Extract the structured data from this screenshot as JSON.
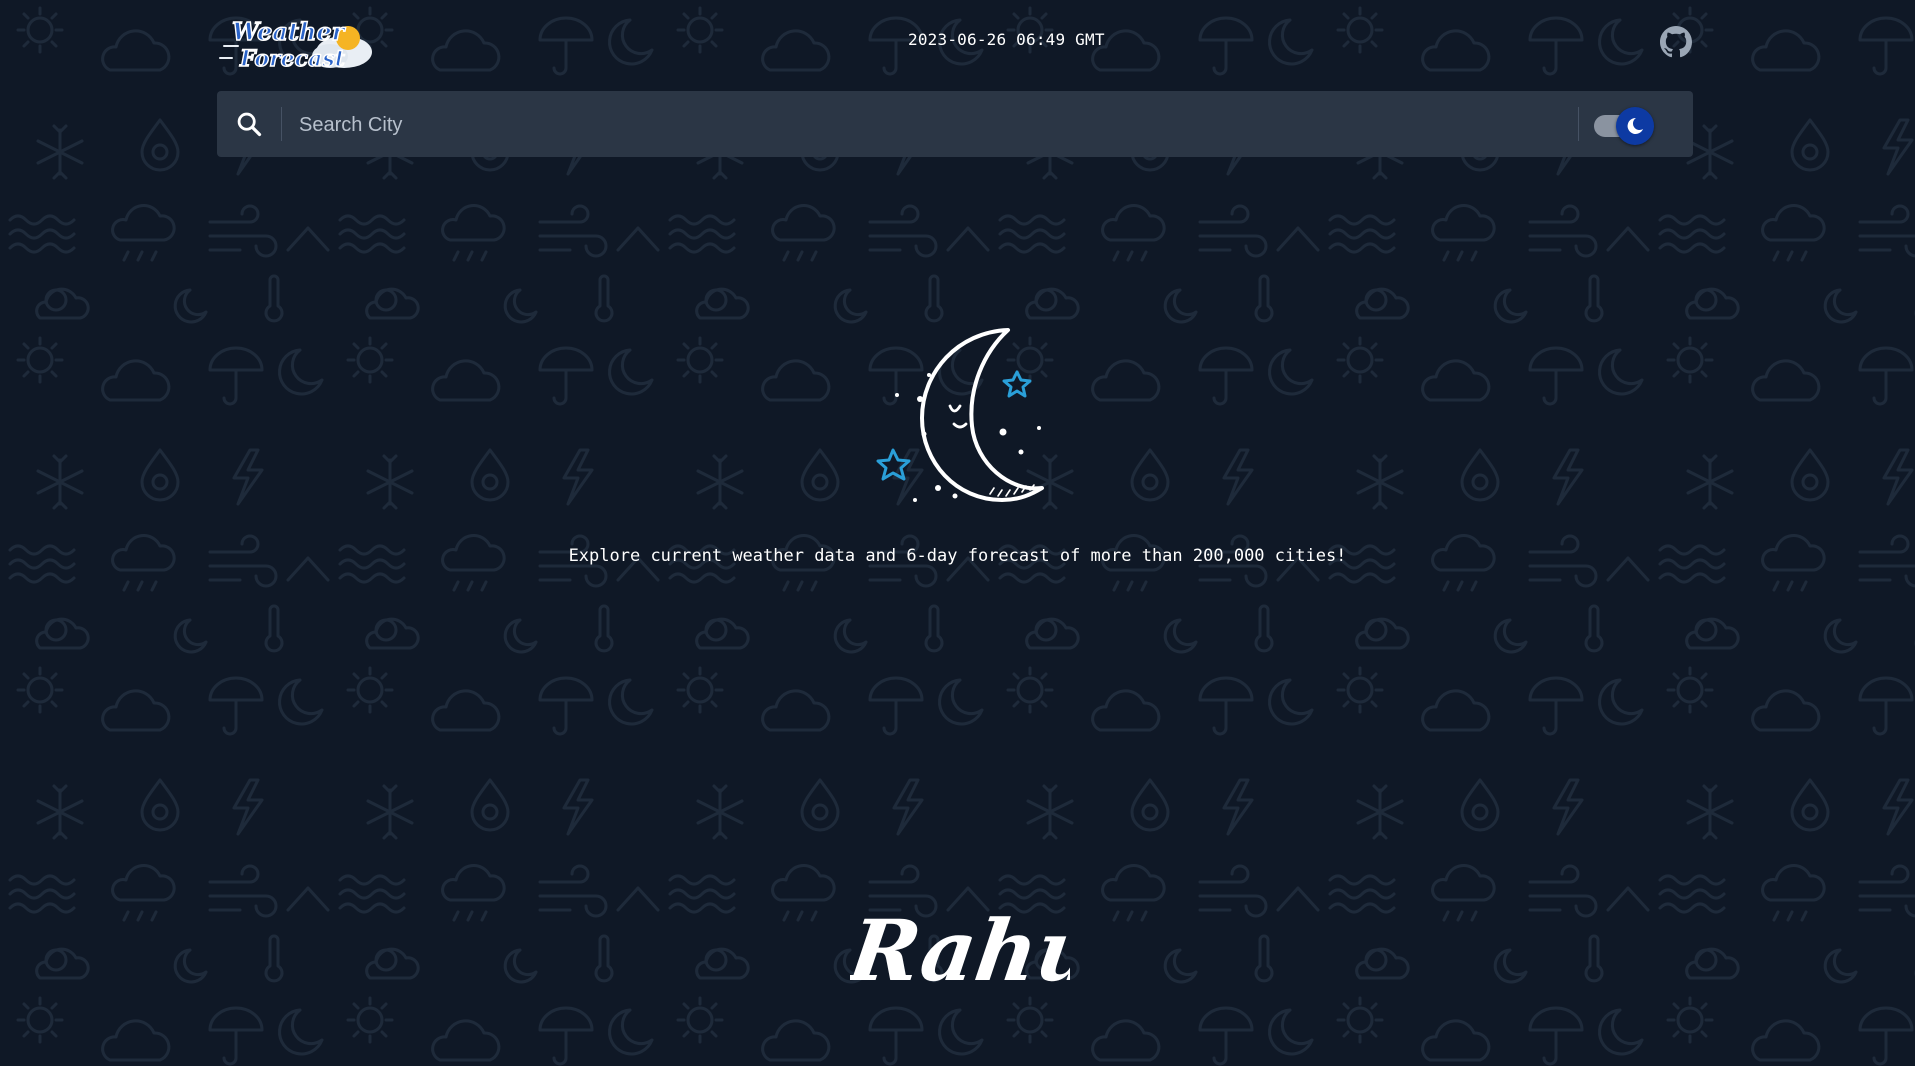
{
  "header": {
    "logo": {
      "line1": "Weather",
      "line2": "Forecast"
    },
    "datetime": "2023-06-26 06:49 GMT",
    "github_icon": "github-icon"
  },
  "search": {
    "placeholder": "Search City",
    "value": "",
    "icon": "search-icon"
  },
  "theme_toggle": {
    "mode": "dark",
    "icon": "moon-icon"
  },
  "hero": {
    "illustration": "sleeping-moon-with-stars",
    "tagline": "Explore current weather data and 6-day forecast of more than 200,000 cities!"
  },
  "footer": {
    "signature": "Rahul"
  },
  "colors": {
    "background": "#0f1826",
    "searchbar": "#2b3645",
    "accent_blue": "#0d3aa3",
    "star_blue": "#2a9fd8",
    "text": "#ffffff"
  }
}
